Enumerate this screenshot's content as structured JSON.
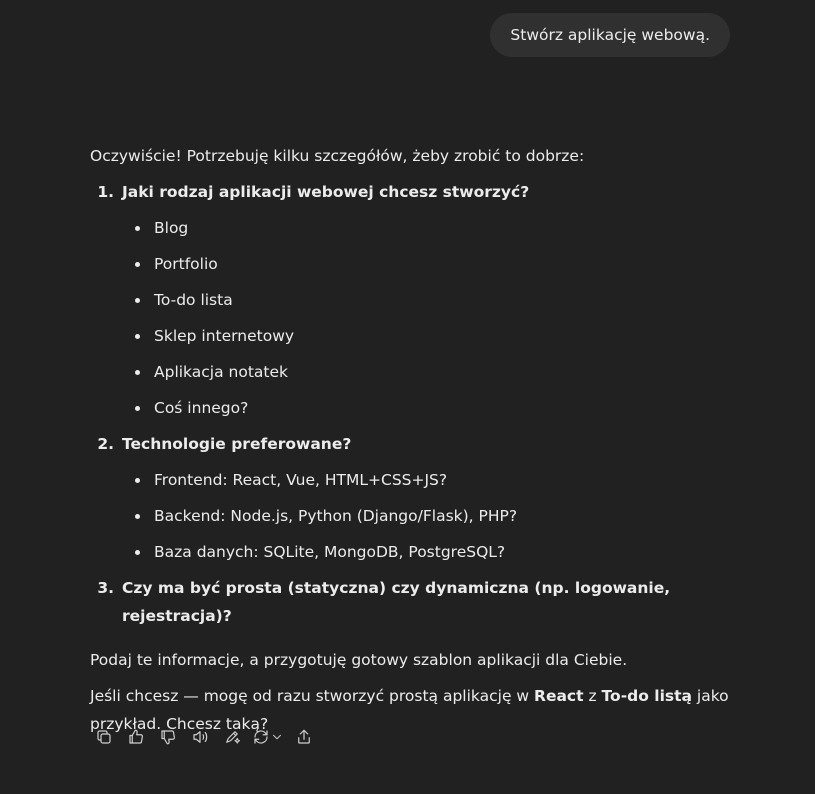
{
  "user_message": "Stwórz aplikację webową.",
  "assistant": {
    "intro": "Oczywiście! Potrzebuję kilku szczegółów, żeby zrobić to dobrze:",
    "questions": [
      {
        "num": "1.",
        "text": "Jaki rodzaj aplikacji webowej chcesz stworzyć?",
        "options": [
          "Blog",
          "Portfolio",
          "To-do lista",
          "Sklep internetowy",
          "Aplikacja notatek",
          "Coś innego?"
        ]
      },
      {
        "num": "2.",
        "text": "Technologie preferowane?",
        "options": [
          "Frontend: React, Vue, HTML+CSS+JS?",
          "Backend: Node.js, Python (Django/Flask), PHP?",
          "Baza danych: SQLite, MongoDB, PostgreSQL?"
        ]
      },
      {
        "num": "3.",
        "text": "Czy ma być prosta (statyczna) czy dynamiczna (np. logowanie, rejestracja)?"
      }
    ],
    "para1": "Podaj te informacje, a przygotuję gotowy szablon aplikacji dla Ciebie.",
    "para2": {
      "pre": "Jeśli chcesz — mogę od razu stworzyć prostą aplikację w ",
      "bold1": "React",
      "mid": " z ",
      "bold2": "To-do listą",
      "post": " jako przykład. Chcesz taką?"
    }
  },
  "toolbar_icons": [
    "copy-icon",
    "thumbs-up-icon",
    "thumbs-down-icon",
    "read-aloud-icon",
    "edit-icon",
    "regenerate-icon",
    "share-icon"
  ]
}
